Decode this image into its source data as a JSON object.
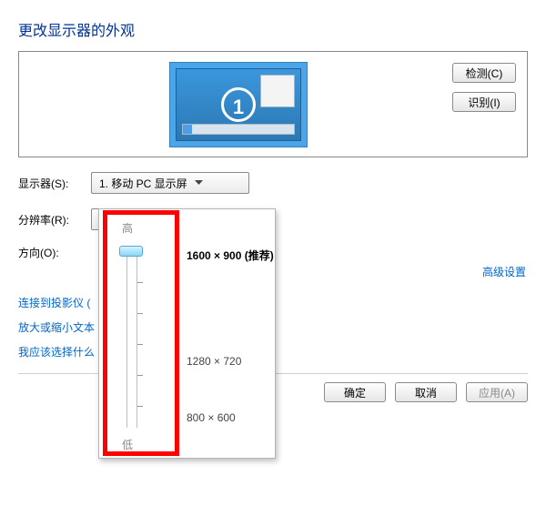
{
  "heading": "更改显示器的外观",
  "monitor_number": "1",
  "side_buttons": {
    "detect": "检测(C)",
    "identify": "识别(I)"
  },
  "labels": {
    "display": "显示器(S):",
    "resolution": "分辨率(R):",
    "orientation": "方向(O):"
  },
  "dropdowns": {
    "display_value": "1. 移动 PC 显示屏",
    "resolution_value": "1600 × 900 (推荐)"
  },
  "slider": {
    "high": "高",
    "low": "低",
    "options": {
      "opt0": "1600 × 900 (推荐)",
      "opt1": "1280 × 720",
      "opt2": "800 × 600"
    }
  },
  "links": {
    "advanced": "高级设置",
    "projector": "连接到投影仪 (",
    "magnify": "放大或缩小文本",
    "which": "我应该选择什么"
  },
  "actions": {
    "ok": "确定",
    "cancel": "取消",
    "apply": "应用(A)"
  }
}
